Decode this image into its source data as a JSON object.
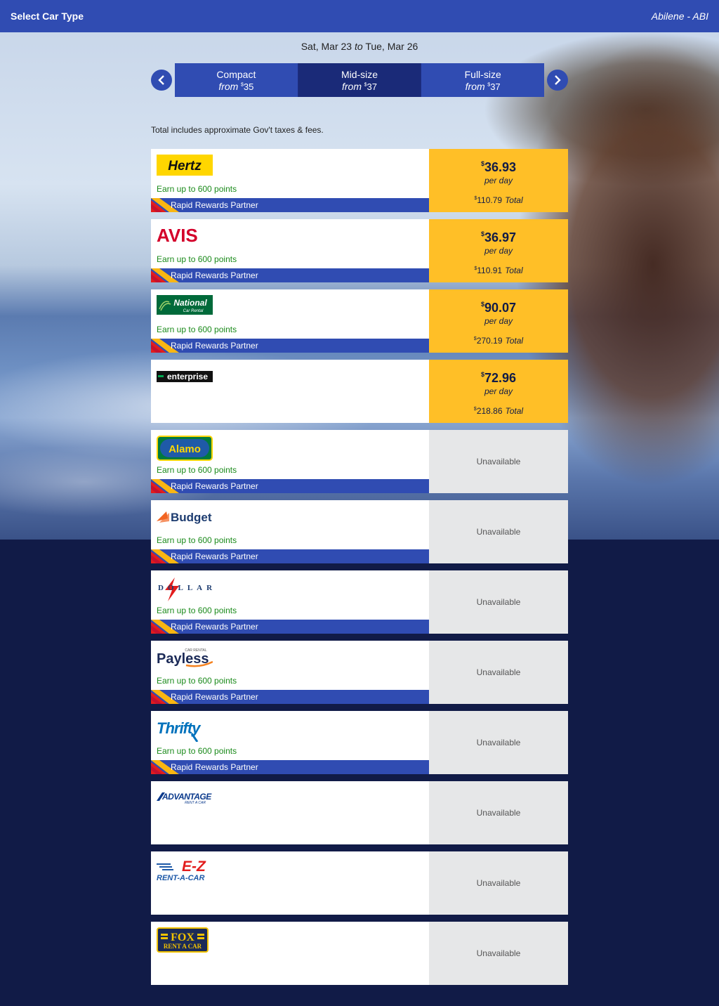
{
  "header": {
    "title": "Select Car Type",
    "location": "Abilene - ABI"
  },
  "dates": {
    "start": "Sat, Mar 23",
    "to": "to",
    "end": "Tue, Mar 26"
  },
  "tabs": [
    {
      "name": "Compact",
      "from_label": "from",
      "currency": "$",
      "price": "35",
      "active": false
    },
    {
      "name": "Mid-size",
      "from_label": "from",
      "currency": "$",
      "price": "37",
      "active": true
    },
    {
      "name": "Full-size",
      "from_label": "from",
      "currency": "$",
      "price": "37",
      "active": false
    }
  ],
  "note": "Total includes approximate Gov't taxes & fees.",
  "common": {
    "earn": "Earn up to 600 points",
    "partner": "Rapid Rewards Partner",
    "unavailable": "Unavailable",
    "per_day": "per day",
    "total_label": "Total",
    "currency": "$"
  },
  "vendors": [
    {
      "id": "hertz",
      "logo_text": "Hertz",
      "partner": true,
      "available": true,
      "daily": "36.93",
      "total": "110.79"
    },
    {
      "id": "avis",
      "logo_text": "AVIS",
      "partner": true,
      "available": true,
      "daily": "36.97",
      "total": "110.91"
    },
    {
      "id": "national",
      "logo_text": "National",
      "logo_sub": "Car Rental",
      "partner": true,
      "available": true,
      "daily": "90.07",
      "total": "270.19"
    },
    {
      "id": "enterprise",
      "logo_text": "enterprise",
      "partner": false,
      "available": true,
      "daily": "72.96",
      "total": "218.86"
    },
    {
      "id": "alamo",
      "logo_text": "Alamo",
      "partner": true,
      "available": false
    },
    {
      "id": "budget",
      "logo_text": "Budget",
      "partner": true,
      "available": false
    },
    {
      "id": "dollar",
      "logo_text": "DOLLAR",
      "partner": true,
      "available": false
    },
    {
      "id": "payless",
      "logo_text": "Payless",
      "logo_sub": "CAR RENTAL",
      "partner": true,
      "available": false
    },
    {
      "id": "thrifty",
      "logo_text": "Thrifty",
      "partner": true,
      "available": false
    },
    {
      "id": "advantage",
      "logo_text": "ADVANTAGE",
      "logo_sub": "RENT A CAR",
      "partner": false,
      "available": false
    },
    {
      "id": "ez",
      "logo_text": "E-Z",
      "logo_sub": "RENT-A-CAR",
      "partner": false,
      "available": false
    },
    {
      "id": "fox",
      "logo_text": "FOX",
      "logo_sub": "RENT A CAR",
      "partner": false,
      "available": false
    }
  ],
  "colors": {
    "brand_blue": "#304cb2",
    "navy": "#111b47",
    "gold": "#ffbf27",
    "earn_green": "#1a8a1a"
  }
}
